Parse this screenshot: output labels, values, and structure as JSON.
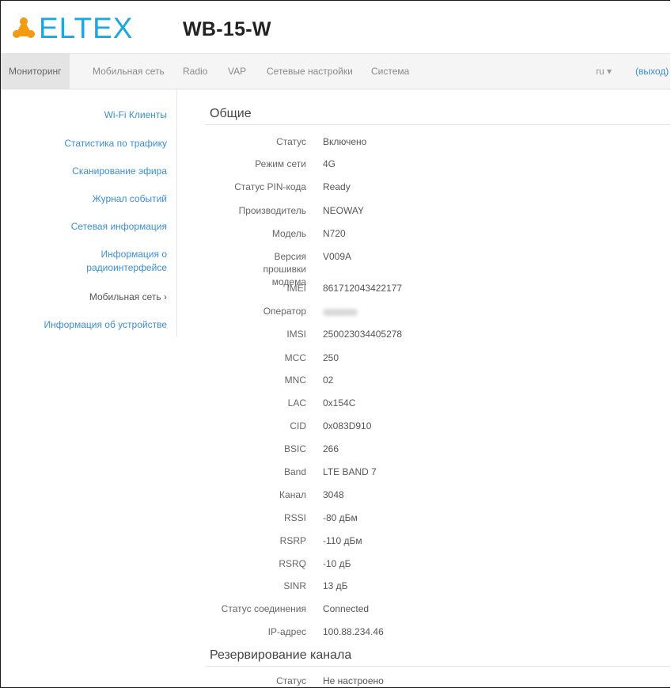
{
  "header": {
    "logo_text": "ELTEX",
    "device_title": "WB-15-W"
  },
  "nav": {
    "items": [
      "Мониторинг",
      "Мобильная сеть",
      "Radio",
      "VAP",
      "Сетевые настройки",
      "Система"
    ],
    "language": "ru ▾",
    "logout": "(выход)"
  },
  "sidebar": {
    "items": [
      "Wi-Fi Клиенты",
      "Статистика по трафику",
      "Сканирование эфира",
      "Журнал событий",
      "Сетевая информация",
      "Информация о радиоинтерфейсе",
      "Мобильная сеть ›",
      "Информация об устройстве"
    ]
  },
  "general": {
    "title": "Общие",
    "rows": [
      {
        "label": "Статус",
        "value": "Включено"
      },
      {
        "label": "Режим сети",
        "value": "4G"
      },
      {
        "label": "Статус PIN-кода",
        "value": "Ready"
      },
      {
        "label": "Производитель",
        "value": "NEOWAY"
      },
      {
        "label": "Модель",
        "value": "N720"
      },
      {
        "label": "Версия прошивки модема",
        "value": "V009A"
      },
      {
        "label": "IMEI",
        "value": "861712043422177"
      },
      {
        "label": "Оператор",
        "value": ""
      },
      {
        "label": "IMSI",
        "value": "250023034405278"
      },
      {
        "label": "MCC",
        "value": "250"
      },
      {
        "label": "MNC",
        "value": "02"
      },
      {
        "label": "LAC",
        "value": "0x154C"
      },
      {
        "label": "CID",
        "value": "0x083D910"
      },
      {
        "label": "BSIC",
        "value": "266"
      },
      {
        "label": "Band",
        "value": "LTE BAND 7"
      },
      {
        "label": "Канал",
        "value": "3048"
      },
      {
        "label": "RSSI",
        "value": "-80 дБм"
      },
      {
        "label": "RSRP",
        "value": "-110 дБм"
      },
      {
        "label": "RSRQ",
        "value": "-10 дБ"
      },
      {
        "label": "SINR",
        "value": "13 дБ"
      },
      {
        "label": "Статус соединения",
        "value": "Connected"
      },
      {
        "label": "IP-адрес",
        "value": "100.88.234.46"
      }
    ]
  },
  "reserve": {
    "title": "Резервирование канала",
    "rows": [
      {
        "label": "Статус",
        "value": "Не настроено"
      }
    ]
  }
}
